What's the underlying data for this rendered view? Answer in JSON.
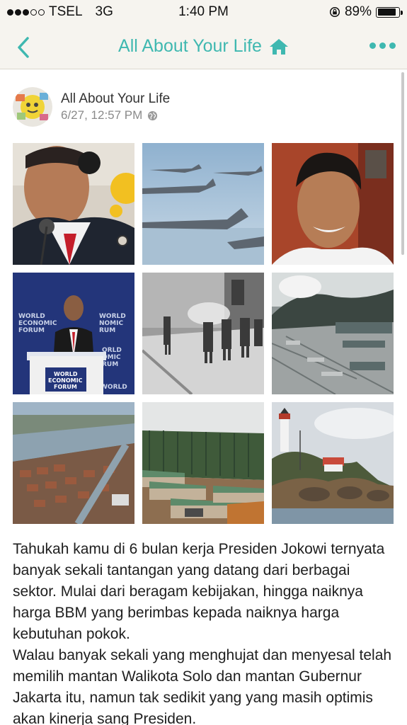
{
  "status_bar": {
    "carrier": "TSEL",
    "network": "3G",
    "time": "1:40 PM",
    "battery_percent": "89%",
    "battery_level": 0.89,
    "signal_bars_filled": 3,
    "signal_bars_total": 5
  },
  "nav": {
    "title": "All About Your Life",
    "accent_color": "#3fb8b0",
    "back_icon": "chevron-left-icon",
    "title_icon": "home-icon",
    "more_icon": "more-horizontal-icon"
  },
  "post": {
    "author": "All About Your Life",
    "timestamp": "6/27, 12:57 PM",
    "privacy_icon": "globe-icon",
    "photos": [
      {
        "name": "photo-president-headset",
        "icon": "photo-icon"
      },
      {
        "name": "photo-fighter-jets",
        "icon": "photo-icon"
      },
      {
        "name": "photo-president-smiling",
        "icon": "photo-icon"
      },
      {
        "name": "photo-world-economic-forum",
        "icon": "photo-icon"
      },
      {
        "name": "photo-execution-scene",
        "icon": "photo-icon"
      },
      {
        "name": "photo-mining-site",
        "icon": "photo-icon"
      },
      {
        "name": "photo-flooded-city",
        "icon": "photo-icon"
      },
      {
        "name": "photo-forest-barracks",
        "icon": "photo-icon"
      },
      {
        "name": "photo-lighthouse",
        "icon": "photo-icon"
      }
    ],
    "body_paragraphs": [
      "Tahukah kamu di 6 bulan kerja Presiden Jokowi ternyata banyak sekali tantangan yang datang dari berbagai sektor. Mulai dari beragam kebijakan, hingga naiknya harga BBM yang berimbas kepada naiknya harga kebutuhan pokok.",
      "Walau banyak sekali yang menghujat dan menyesal telah memilih mantan Walikota Solo dan mantan Gubernur Jakarta itu, namun tak sedikit yang yang masih optimis akan kinerja sang Presiden."
    ]
  }
}
